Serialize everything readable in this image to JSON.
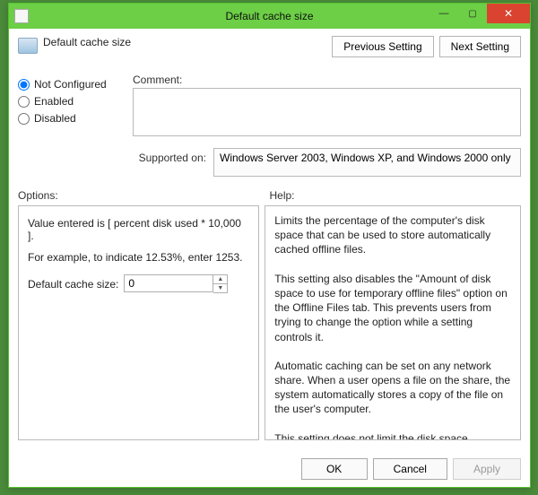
{
  "window": {
    "title": "Default cache size"
  },
  "header": {
    "policy_title": "Default cache size",
    "previous_setting": "Previous Setting",
    "next_setting": "Next Setting"
  },
  "state": {
    "not_configured": "Not Configured",
    "enabled": "Enabled",
    "disabled": "Disabled",
    "selected": "not_configured",
    "comment_label": "Comment:",
    "comment_value": "",
    "supported_label": "Supported on:",
    "supported_value": "Windows Server 2003, Windows XP, and Windows 2000 only"
  },
  "labels": {
    "options": "Options:",
    "help": "Help:"
  },
  "options": {
    "line1": "Value entered is [ percent disk used * 10,000 ].",
    "line2": "For example, to indicate 12.53%, enter 1253.",
    "cache_label": "Default cache size:",
    "cache_value": "0"
  },
  "help_text": "Limits the percentage of the computer's disk space that can be used to store automatically cached offline files.\n\nThis setting also disables the \"Amount of disk space to use for temporary offline files\" option on the Offline Files tab. This prevents users from trying to change the option while a setting controls it.\n\nAutomatic caching can be set on any network share. When a user opens a file on the share, the system automatically stores a copy of the file on the user's computer.\n\nThis setting does not limit the disk space available for files that user's make available offline manually.\n\nIf you enable this setting, you can specify an automatic-cache disk space limit.\n\nIf you disable this setting, the system limits the space that automatically cached files occupy to 10 percent of the space on the system drive.",
  "footer": {
    "ok": "OK",
    "cancel": "Cancel",
    "apply": "Apply"
  }
}
